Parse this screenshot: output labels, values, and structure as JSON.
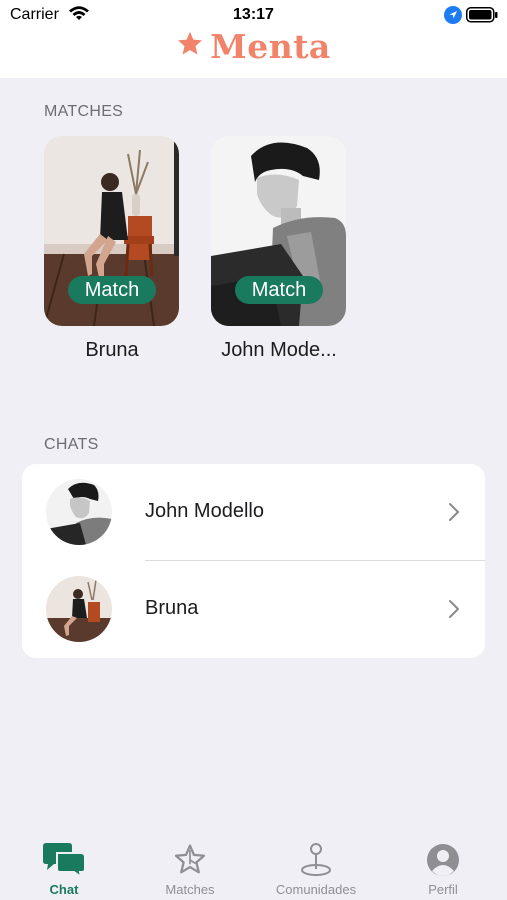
{
  "status_bar": {
    "carrier": "Carrier",
    "time": "13:17"
  },
  "header": {
    "brand_name": "Menta",
    "brand_icon": "star-icon",
    "brand_color": "#f2836b"
  },
  "matches": {
    "section_title": "MATCHES",
    "items": [
      {
        "name": "Bruna",
        "badge": "Match"
      },
      {
        "name": "John Mode...",
        "badge": "Match"
      }
    ]
  },
  "chats": {
    "section_title": "CHATS",
    "items": [
      {
        "name": "John Modello"
      },
      {
        "name": "Bruna"
      }
    ]
  },
  "tabbar": {
    "active_color": "#1a7a5e",
    "tabs": [
      {
        "label": "Chat",
        "icon": "chat-bubbles-icon",
        "active": true
      },
      {
        "label": "Matches",
        "icon": "star-outline-icon",
        "active": false
      },
      {
        "label": "Comunidades",
        "icon": "map-pin-icon",
        "active": false
      },
      {
        "label": "Perfil",
        "icon": "person-circle-icon",
        "active": false
      }
    ]
  }
}
